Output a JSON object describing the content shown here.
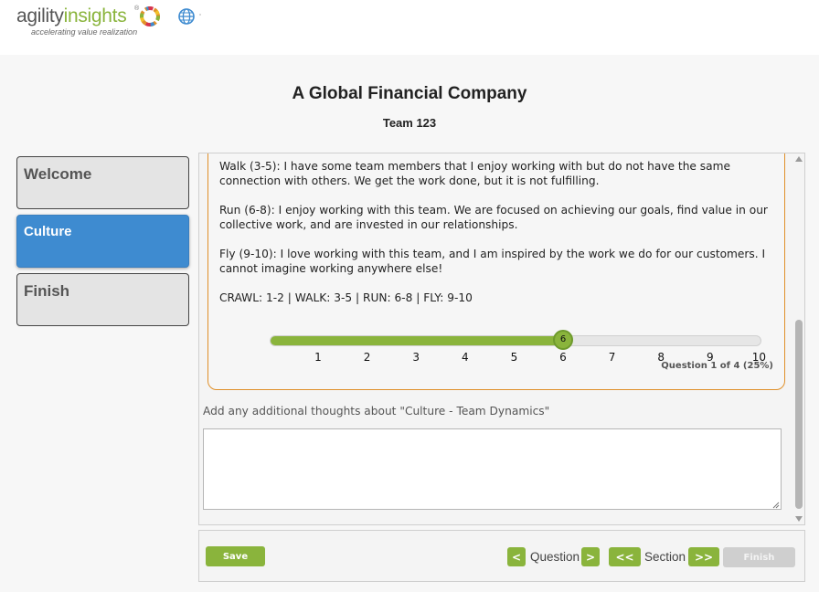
{
  "brand": {
    "agility": "agility",
    "insights": "insights",
    "tm": "®",
    "tagline": "accelerating value realization",
    "logo_mark_icon": "color-ring-icon",
    "language_icon": "globe-icon",
    "colors": {
      "green": "#8ab43c",
      "gray": "#555555",
      "blue": "#3e8bd0",
      "orange": "#e0902a"
    }
  },
  "header": {
    "company": "A Global Financial Company",
    "team": "Team 123"
  },
  "sidebar": {
    "items": [
      {
        "label": "Welcome",
        "active": false
      },
      {
        "label": "Culture",
        "active": true
      },
      {
        "label": "Finish",
        "active": false
      }
    ]
  },
  "question": {
    "paragraphs": [
      "Walk (3-5): I have some team members that I enjoy working with but do not have the same connection with others. We get the work done, but it is not fulfilling.",
      "Run (6-8): I enjoy working with this team. We are focused on achieving our goals, find value in our collective work, and are invested in our relationships.",
      "Fly (9-10): I love working with this team, and I am inspired by the work we do for our customers. I cannot imagine working anywhere else!",
      "CRAWL: 1-2 | WALK: 3-5 | RUN: 6-8 | FLY: 9-10"
    ],
    "slider": {
      "min": 1,
      "max": 10,
      "value": 6,
      "value_label": "6",
      "ticks": [
        "1",
        "2",
        "3",
        "4",
        "5",
        "6",
        "7",
        "8",
        "9",
        "10"
      ]
    },
    "progress": "Question 1 of 4 (25%)"
  },
  "thoughts": {
    "label": "Add any additional thoughts about \"Culture - Team Dynamics\"",
    "value": ""
  },
  "footer": {
    "save": "Save",
    "question_prev": "<",
    "question_label": "Question",
    "question_next": ">",
    "section_prev": "<<",
    "section_label": "Section",
    "section_next": ">>",
    "finish": "Finish"
  }
}
